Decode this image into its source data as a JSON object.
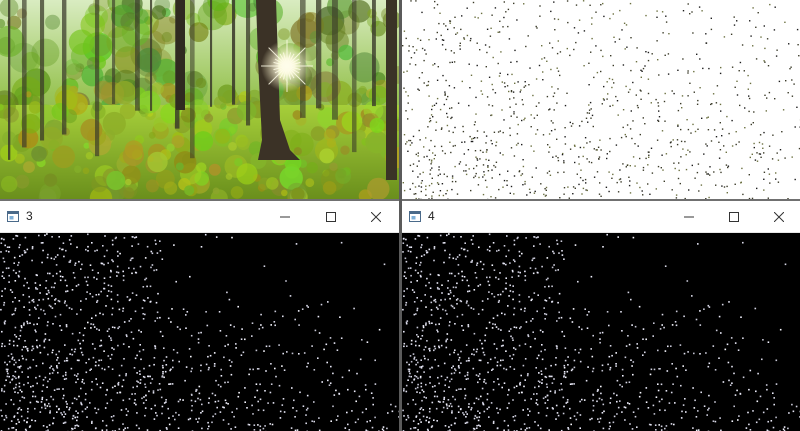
{
  "windows": [
    {
      "id": "1",
      "title": ""
    },
    {
      "id": "2",
      "title": ""
    },
    {
      "id": "3",
      "title": "3",
      "minimize_icon": "minimize-icon",
      "maximize_icon": "maximize-icon",
      "close_icon": "close-icon"
    },
    {
      "id": "4",
      "title": "4",
      "minimize_icon": "minimize-icon",
      "maximize_icon": "maximize-icon",
      "close_icon": "close-icon"
    }
  ],
  "colors": {
    "forest_sky": "#dfeecb",
    "forest_canopy": "#5f8f2a",
    "forest_ground": "#8fbf28",
    "dot_dark": "#4a4a30",
    "dot_light": "#dcd8f0",
    "black": "#000000"
  }
}
